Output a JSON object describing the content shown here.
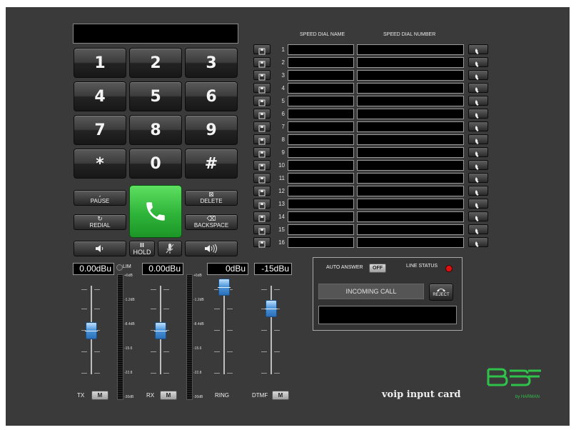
{
  "keypad": {
    "keys": [
      "1",
      "2",
      "3",
      "4",
      "5",
      "6",
      "7",
      "8",
      "9",
      "*",
      "0",
      "#"
    ]
  },
  "functions": {
    "pause": "PAUSE",
    "pause_glyph": ",",
    "delete": "DELETE",
    "delete_glyph": "⊠",
    "redial": "REDIAL",
    "redial_glyph": "↻",
    "backspace": "BACKSPACE",
    "backspace_glyph": "⌫",
    "hold": "HOLD",
    "hold_glyph": "II"
  },
  "speed_dial": {
    "name_header": "SPEED DIAL NAME",
    "number_header": "SPEED DIAL NUMBER",
    "numbers": [
      "1",
      "2",
      "3",
      "4",
      "5",
      "6",
      "7",
      "8",
      "9",
      "10",
      "11",
      "12",
      "13",
      "14",
      "15",
      "16"
    ]
  },
  "levels": {
    "tx_value": "0.00dBu",
    "rx_value": "0.00dBu",
    "ring_value": "0dBu",
    "dtmf_value": "-15dBu",
    "lim_label": "LIM",
    "meter_scale": [
      "+6dB",
      "-1.2dB",
      "-8.4dB",
      "-15.6",
      "-22.8",
      "-30dB"
    ],
    "tx_label": "TX",
    "rx_label": "RX",
    "ring_label": "RING",
    "dtmf_label": "DTMF",
    "mute_label": "M"
  },
  "status": {
    "auto_answer_label": "AUTO ANSWER",
    "auto_answer_value": "OFF",
    "line_status_label": "LINE STATUS",
    "incoming_call": "INCOMING CALL",
    "reject_label": "REJECT",
    "led_color": "#e01010"
  },
  "brand": {
    "card_name": "voip input card",
    "logo_sub": "by HARMAN",
    "logo_color": "#2fc14a"
  }
}
